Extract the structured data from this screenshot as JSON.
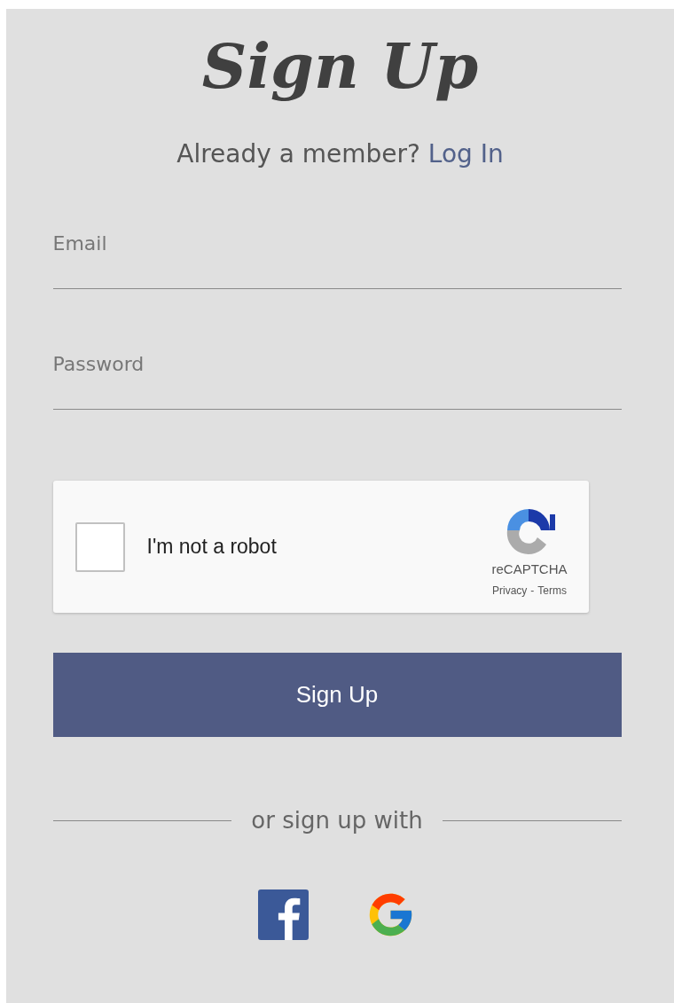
{
  "title": "Sign Up",
  "login_prompt": {
    "text": "Already a member?",
    "link": "Log In"
  },
  "fields": [
    {
      "label": "Email"
    },
    {
      "label": "Password"
    }
  ],
  "captcha": {
    "label": "I'm not a robot",
    "checked": false,
    "brand": "reCAPTCHA",
    "privacy": "Privacy",
    "separator": "-",
    "terms": "Terms"
  },
  "submit": "Sign Up",
  "divider": "or sign up with"
}
